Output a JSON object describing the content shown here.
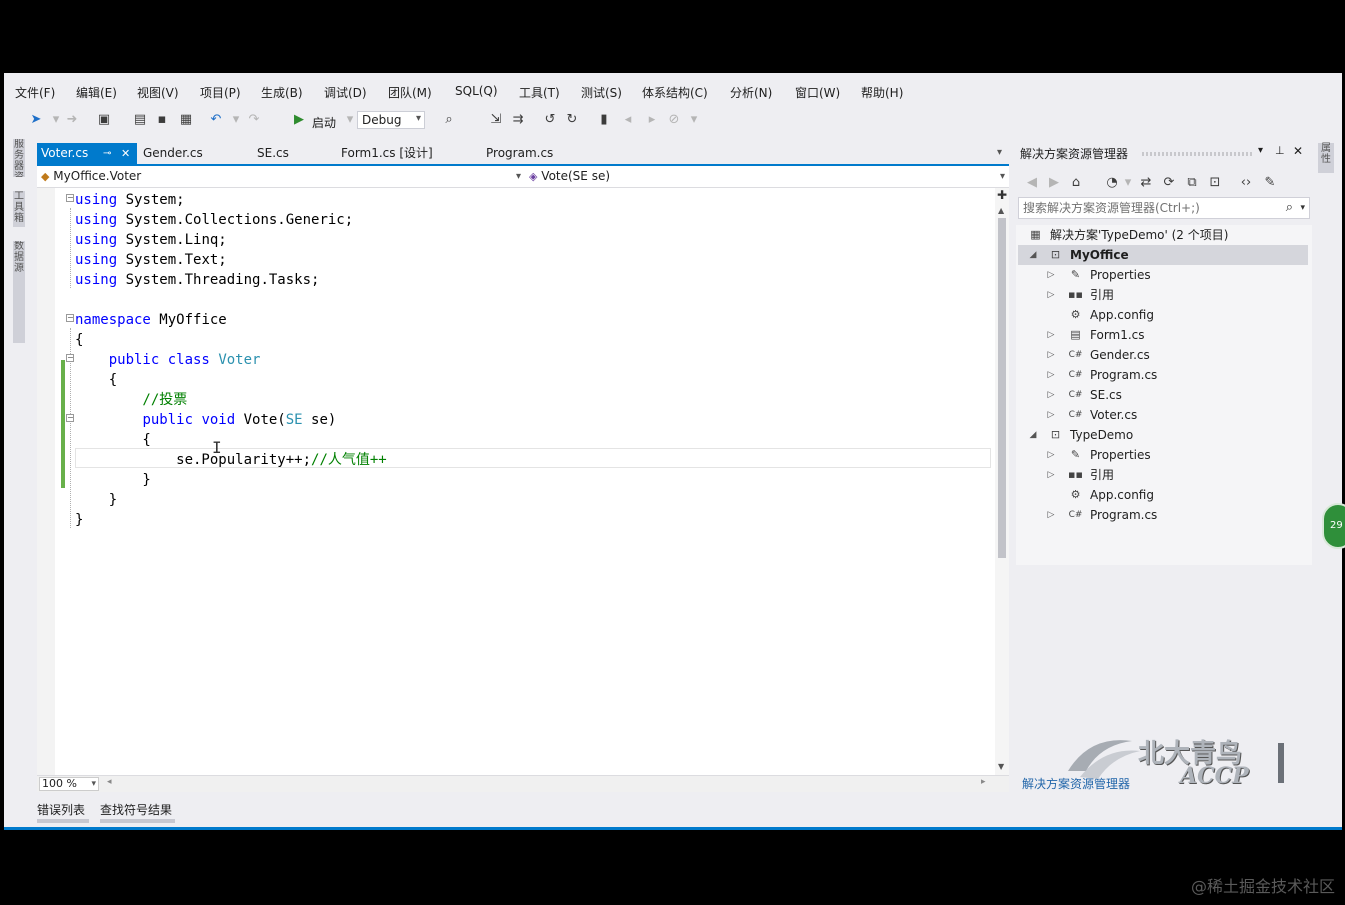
{
  "menu": [
    "文件(F)",
    "编辑(E)",
    "视图(V)",
    "项目(P)",
    "生成(B)",
    "调试(D)",
    "团队(M)",
    "SQL(Q)",
    "工具(T)",
    "测试(S)",
    "体系结构(C)",
    "分析(N)",
    "窗口(W)",
    "帮助(H)"
  ],
  "toolbar": {
    "start_label": "启动",
    "config_value": "Debug"
  },
  "left_strip": [
    "服务器资源管理器",
    "工具箱",
    "数据源"
  ],
  "tabs": [
    {
      "label": "Voter.cs",
      "active": true
    },
    {
      "label": "Gender.cs"
    },
    {
      "label": "SE.cs"
    },
    {
      "label": "Form1.cs [设计]"
    },
    {
      "label": "Program.cs"
    }
  ],
  "nav": {
    "class_value": "MyOffice.Voter",
    "member_value": "Vote(SE se)"
  },
  "code": [
    "using System;",
    "using System.Collections.Generic;",
    "using System.Linq;",
    "using System.Text;",
    "using System.Threading.Tasks;",
    "",
    "namespace MyOffice",
    "{",
    "    public class Voter",
    "    {",
    "        //投票",
    "        public void Vote(SE se)",
    "        {",
    "            se.Popularity++;//人气值++",
    "        }",
    "    }",
    "}"
  ],
  "zoom": "100 %",
  "bottom_tabs": [
    "错误列表",
    "查找符号结果"
  ],
  "solution_explorer": {
    "title": "解决方案资源管理器",
    "search_placeholder": "搜索解决方案资源管理器(Ctrl+;)",
    "footer_tab": "解决方案资源管理器",
    "tree": [
      {
        "label": "解决方案'TypeDemo' (2 个项目)",
        "level": 0,
        "icon": "solution-icon",
        "arrow": ""
      },
      {
        "label": "MyOffice",
        "level": 0,
        "icon": "csharp-project-icon",
        "arrow": "expanded",
        "selected": true,
        "bold": true
      },
      {
        "label": "Properties",
        "level": 1,
        "icon": "wrench-icon",
        "arrow": "collapsed"
      },
      {
        "label": "引用",
        "level": 1,
        "icon": "references-icon",
        "arrow": "collapsed"
      },
      {
        "label": "App.config",
        "level": 1,
        "icon": "config-file-icon",
        "arrow": ""
      },
      {
        "label": "Form1.cs",
        "level": 1,
        "icon": "form-icon",
        "arrow": "collapsed"
      },
      {
        "label": "Gender.cs",
        "level": 1,
        "icon": "csharp-file-icon",
        "arrow": "collapsed"
      },
      {
        "label": "Program.cs",
        "level": 1,
        "icon": "csharp-file-icon",
        "arrow": "collapsed"
      },
      {
        "label": "SE.cs",
        "level": 1,
        "icon": "csharp-file-icon",
        "arrow": "collapsed"
      },
      {
        "label": "Voter.cs",
        "level": 1,
        "icon": "csharp-file-icon",
        "arrow": "collapsed"
      },
      {
        "label": "TypeDemo",
        "level": 0,
        "icon": "csharp-project-icon",
        "arrow": "expanded"
      },
      {
        "label": "Properties",
        "level": 1,
        "icon": "wrench-icon",
        "arrow": "collapsed"
      },
      {
        "label": "引用",
        "level": 1,
        "icon": "references-icon",
        "arrow": "collapsed"
      },
      {
        "label": "App.config",
        "level": 1,
        "icon": "config-file-icon",
        "arrow": ""
      },
      {
        "label": "Program.cs",
        "level": 1,
        "icon": "csharp-file-icon",
        "arrow": "collapsed"
      }
    ]
  },
  "right_strip": "属性",
  "badge": "29",
  "logo": {
    "line1": "北大青鸟",
    "line2": "ACCP"
  },
  "watermark": "@稀土掘金技术社区"
}
